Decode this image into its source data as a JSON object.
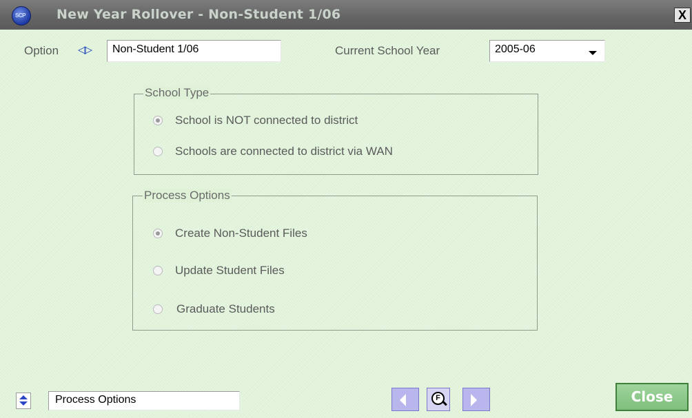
{
  "window": {
    "title": "New Year Rollover  -  Non-Student 1/06",
    "close_glyph": "X",
    "logo_text": "SCP"
  },
  "option": {
    "label": "Option",
    "updown_icon": "left-right-arrows-icon",
    "value": "Non-Student 1/06"
  },
  "school_year": {
    "label": "Current School Year",
    "value": "2005-06"
  },
  "school_type": {
    "legend": "School Type",
    "options": [
      {
        "label": "School is NOT connected to district",
        "selected": true
      },
      {
        "label": "Schools are connected to district via WAN",
        "selected": false
      }
    ]
  },
  "process_options": {
    "legend": "Process Options",
    "options": [
      {
        "label": "Create Non-Student Files",
        "selected": true
      },
      {
        "label": "Update Student Files",
        "selected": false
      },
      {
        "label": "Graduate Students",
        "selected": false
      }
    ]
  },
  "footer": {
    "section_value": "Process Options",
    "find_glyph": "F",
    "close_label": "Close"
  },
  "colors": {
    "background": "#dff2d8",
    "titlebar": "#6a6a6a",
    "nav_button": "#b9b6ee",
    "close_button": "#8fca8c"
  }
}
